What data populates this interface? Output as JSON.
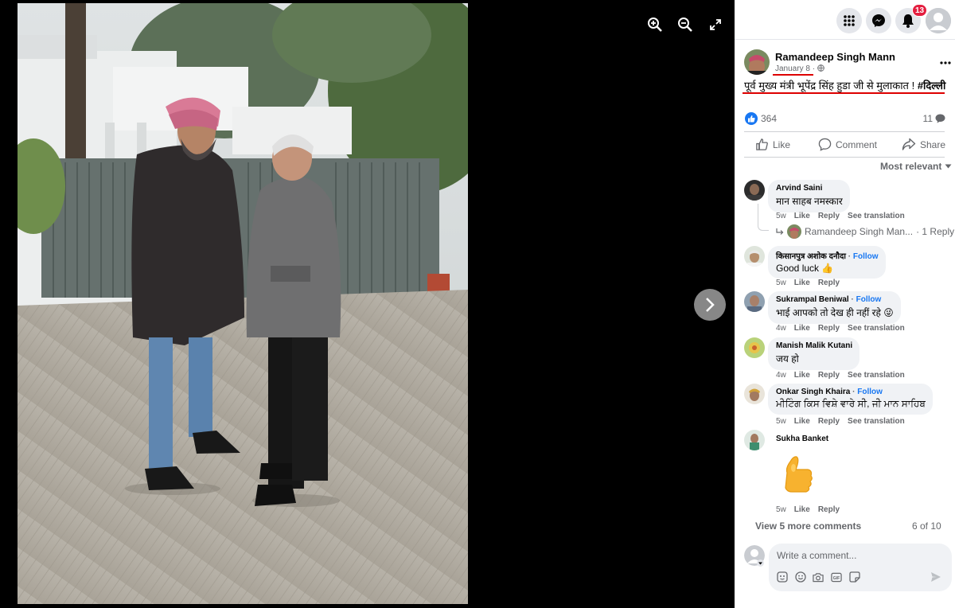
{
  "viewer": {
    "zoom_in_icon": "zoom-in-icon",
    "zoom_out_icon": "zoom-out-icon",
    "expand_icon": "expand-icon",
    "next_icon": "chevron-right-icon"
  },
  "topbar": {
    "notifications_count": "13"
  },
  "post": {
    "author": "Ramandeep Singh Mann",
    "date": "January 8 ·",
    "text_main": "पूर्व मुख्य मंत्री भूपेंद्र सिंह हुडा जी से मुलाकात ! ",
    "text_hashtag": "#दिल्ली",
    "like_count": "364",
    "comment_count": "11",
    "actions": {
      "like": "Like",
      "comment": "Comment",
      "share": "Share"
    },
    "sort_label": "Most relevant"
  },
  "comments": [
    {
      "name": "Arvind Saini",
      "follow": "",
      "text": "मान साहब नमस्कार",
      "time": "5w",
      "like": "Like",
      "reply": "Reply",
      "translate": "See translation"
    },
    {
      "name": "किसानपुत्र अशोक दनौदा",
      "follow": "Follow",
      "text": "Good luck 👍",
      "time": "5w",
      "like": "Like",
      "reply": "Reply",
      "translate": ""
    },
    {
      "name": "Sukrampal Beniwal",
      "follow": "Follow",
      "text": "भाई आपको तो देख ही नहीं रहे 😜",
      "time": "4w",
      "like": "Like",
      "reply": "Reply",
      "translate": "See translation"
    },
    {
      "name": "Manish Malik Kutani",
      "follow": "",
      "text": "जय हो",
      "time": "4w",
      "like": "Like",
      "reply": "Reply",
      "translate": "See translation"
    },
    {
      "name": "Onkar Singh Khaira",
      "follow": "Follow",
      "text": "ਮੀਟਿੰਗ ਕਿਸ ਵਿਸ਼ੇ ਵਾਰੇ ਸੀ, ਜੀ ਮਾਨ ਸਾਹਿਬ",
      "time": "5w",
      "like": "Like",
      "reply": "Reply",
      "translate": "See translation"
    },
    {
      "name": "Sukha Banket",
      "follow": "",
      "text": "",
      "time": "5w",
      "like": "Like",
      "reply": "Reply",
      "translate": ""
    }
  ],
  "reply_preview": {
    "name": "Ramandeep Singh Man...",
    "count": "· 1 Reply"
  },
  "view_more": "View 5 more comments",
  "page_count": "6 of 10",
  "composer": {
    "placeholder": "Write a comment..."
  },
  "colors": {
    "accent": "#1877f2",
    "annotation": "#dd0000",
    "badge": "#e41e3f"
  }
}
